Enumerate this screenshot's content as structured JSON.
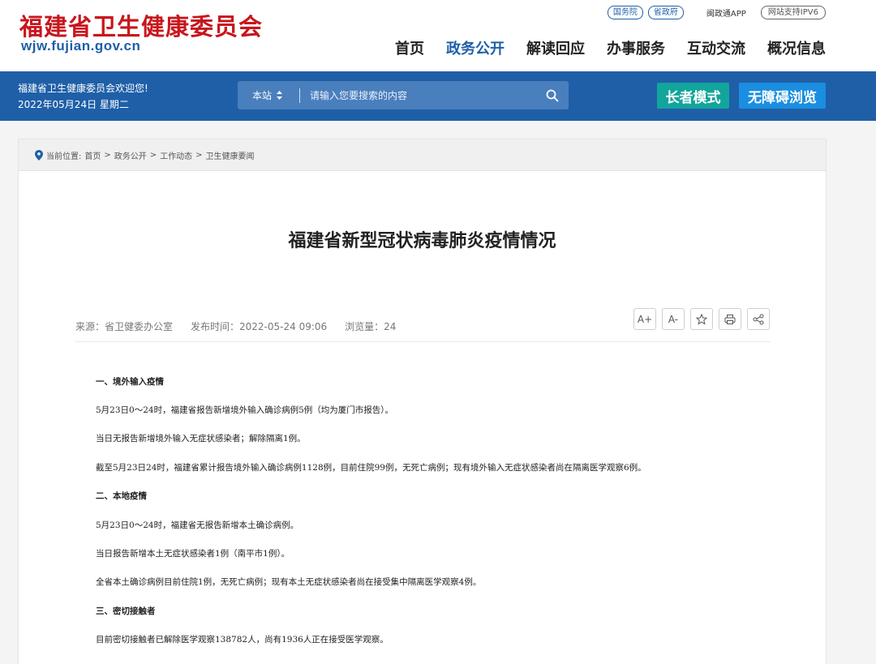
{
  "header": {
    "logo_cn": "福建省卫生健康委员会",
    "logo_en": "wjw.fujian.gov.cn",
    "top_links": [
      "国务院",
      "省政府"
    ],
    "app_link": "闽政通APP",
    "ipv6": "网站支持IPV6",
    "nav": [
      "首页",
      "政务公开",
      "解读回应",
      "办事服务",
      "互动交流",
      "概况信息"
    ]
  },
  "bar": {
    "welcome": "福建省卫生健康委员会欢迎您!",
    "date": "2022年05月24日 星期二",
    "search_scope": "本站",
    "search_placeholder": "请输入您要搜索的内容",
    "elder_mode": "长者模式",
    "accessible": "无障碍浏览"
  },
  "breadcrumb": {
    "prefix": "当前位置:",
    "items": [
      "首页",
      "政务公开",
      "工作动态",
      "卫生健康要闻"
    ]
  },
  "article": {
    "title": "福建省新型冠状病毒肺炎疫情情况",
    "source": "来源：省卫健委办公室",
    "time": "发布时间：2022-05-24 09:06",
    "views": "浏览量：24",
    "tools": [
      "A+",
      "A-"
    ],
    "paragraphs": [
      {
        "text": "一、境外输入疫情",
        "h": true
      },
      {
        "text": "5月23日0～24时，福建省报告新增境外输入确诊病例5例（均为厦门市报告）。",
        "h": false
      },
      {
        "text": "当日无报告新增境外输入无症状感染者；解除隔离1例。",
        "h": false
      },
      {
        "text": "截至5月23日24时，福建省累计报告境外输入确诊病例1128例，目前住院99例，无死亡病例；现有境外输入无症状感染者尚在隔离医学观察6例。",
        "h": false
      },
      {
        "text": "二、本地疫情",
        "h": true
      },
      {
        "text": "5月23日0～24时，福建省无报告新增本土确诊病例。",
        "h": false
      },
      {
        "text": "当日报告新增本土无症状感染者1例（南平市1例）。",
        "h": false
      },
      {
        "text": "全省本土确诊病例目前住院1例，无死亡病例；现有本土无症状感染者尚在接受集中隔离医学观察4例。",
        "h": false
      },
      {
        "text": "三、密切接触者",
        "h": true
      },
      {
        "text": "目前密切接触者已解除医学观察138782人，尚有1936人正在接受医学观察。",
        "h": false
      }
    ]
  }
}
